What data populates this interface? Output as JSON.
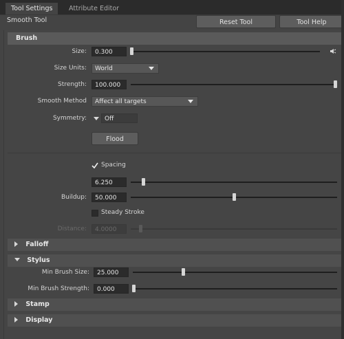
{
  "tabs": [
    {
      "label": "Tool Settings",
      "active": true
    },
    {
      "label": "Attribute Editor",
      "active": false
    }
  ],
  "tool_name": "Smooth Tool",
  "buttons": {
    "reset": "Reset Tool",
    "help": "Tool Help"
  },
  "brush": {
    "title": "Brush",
    "size": {
      "label": "Size:",
      "value": "0.300",
      "level": 0.0
    },
    "size_units": {
      "label": "Size Units:",
      "value": "World"
    },
    "strength": {
      "label": "Strength:",
      "value": "100.000",
      "level": 1.0
    },
    "smooth_method": {
      "label": "Smooth Method",
      "value": "Affect all targets"
    },
    "symmetry": {
      "label": "Symmetry:",
      "value": "Off"
    },
    "flood": "Flood"
  },
  "spacing": {
    "checkbox_label": "Spacing",
    "checked": true,
    "value": "6.250",
    "level": 0.04
  },
  "buildup": {
    "label": "Buildup:",
    "value": "50.000",
    "level": 0.5
  },
  "steady_stroke": {
    "label": "Steady Stroke",
    "checked": false
  },
  "distance": {
    "label": "Distance:",
    "value": "4.0000",
    "enabled": false
  },
  "falloff": {
    "title": "Falloff",
    "expanded": false
  },
  "stylus": {
    "title": "Stylus",
    "expanded": true,
    "min_brush_size": {
      "label": "Min Brush Size:",
      "value": "25.000",
      "level": 0.25
    },
    "min_brush_strength": {
      "label": "Min Brush Strength:",
      "value": "0.000",
      "level": 0.0
    }
  },
  "stamp": {
    "title": "Stamp",
    "expanded": false
  },
  "display": {
    "title": "Display",
    "expanded": false
  },
  "colors": {
    "background": "#444444",
    "field": "#2b2b2b",
    "section_header": "#5a5a5a"
  }
}
